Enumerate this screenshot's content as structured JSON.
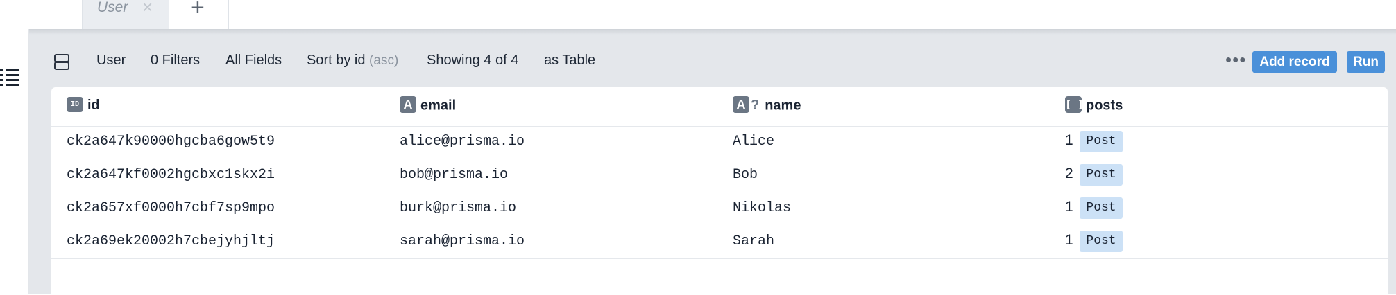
{
  "tabs": [
    {
      "label": "User",
      "close": "×"
    }
  ],
  "tab_add": "+",
  "toolbar": {
    "model": "User",
    "filters": "0 Filters",
    "fields": "All Fields",
    "sort": "Sort by id",
    "sort_dir": "(asc)",
    "showing": "Showing 4 of 4",
    "view": "as Table",
    "more": "•••",
    "add_record": "Add record",
    "run": "Run"
  },
  "columns": [
    {
      "badge": "ID",
      "name": "id"
    },
    {
      "badge": "A",
      "name": "email"
    },
    {
      "badge": "A",
      "optional": "?",
      "name": "name"
    },
    {
      "badge": "[ ]",
      "name": "posts"
    }
  ],
  "rows": [
    {
      "id": "ck2a647k90000hgcba6gow5t9",
      "email": "alice@prisma.io",
      "name": "Alice",
      "posts_count": "1",
      "posts_label": "Post"
    },
    {
      "id": "ck2a647kf0002hgcbxc1skx2i",
      "email": "bob@prisma.io",
      "name": "Bob",
      "posts_count": "2",
      "posts_label": "Post"
    },
    {
      "id": "ck2a657xf0000h7cbf7sp9mpo",
      "email": "burk@prisma.io",
      "name": "Nikolas",
      "posts_count": "1",
      "posts_label": "Post"
    },
    {
      "id": "ck2a69ek20002h7cbejyhjltj",
      "email": "sarah@prisma.io",
      "name": "Sarah",
      "posts_count": "1",
      "posts_label": "Post"
    }
  ],
  "colors": {
    "accent": "#4a90d9",
    "pill": "#cce1f6",
    "panel": "#e4e7eb",
    "badge": "#6b7684"
  }
}
